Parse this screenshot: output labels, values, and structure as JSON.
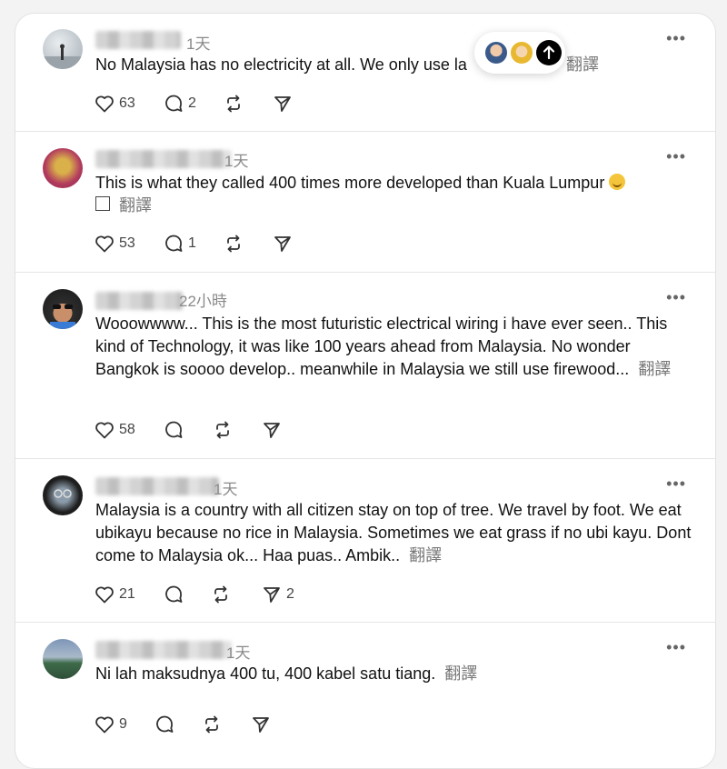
{
  "posts": [
    {
      "time": "1天",
      "text": "No Malaysia has no electricity at all. We only use la",
      "translate": "翻譯",
      "likes": "63",
      "replies": "2",
      "reposts": "",
      "shares": ""
    },
    {
      "time": "1天",
      "text": "This is what they called 400 times more developed than Kuala Lumpur",
      "translate": "翻譯",
      "likes": "53",
      "replies": "1",
      "reposts": "",
      "shares": ""
    },
    {
      "time": "22小時",
      "text": "Wooowwww... This is the most futuristic electrical wiring i have ever seen.. This kind of Technology, it was like 100 years ahead from Malaysia. No wonder Bangkok is soooo develop.. meanwhile in Malaysia we still use firewood...",
      "translate": "翻譯",
      "likes": "58",
      "replies": "",
      "reposts": "",
      "shares": ""
    },
    {
      "time": "1天",
      "text": "Malaysia is a country with all citizen stay on top of tree. We travel by foot. We eat ubikayu because no rice in Malaysia. Sometimes we eat grass if no ubi kayu. Dont come to Malaysia ok... Haa puas.. Ambik..",
      "translate": "翻譯",
      "likes": "21",
      "replies": "",
      "reposts": "",
      "shares": "2"
    },
    {
      "time": "1天",
      "text": "Ni lah maksudnya 400 tu, 400 kabel satu tiang.",
      "translate": "翻譯",
      "likes": "9",
      "replies": "",
      "reposts": "",
      "shares": ""
    }
  ],
  "more_label": "•••",
  "icons": {
    "like": "heart-icon",
    "reply": "speech-bubble-icon",
    "repost": "repost-arrows-icon",
    "share": "paper-plane-icon",
    "scroll_top": "arrow-up-icon",
    "emoji": "pensive-face-emoji-icon"
  },
  "colors": {
    "accent": "#000000",
    "muted": "#8a8a8a",
    "divider": "#e6e6e6"
  }
}
